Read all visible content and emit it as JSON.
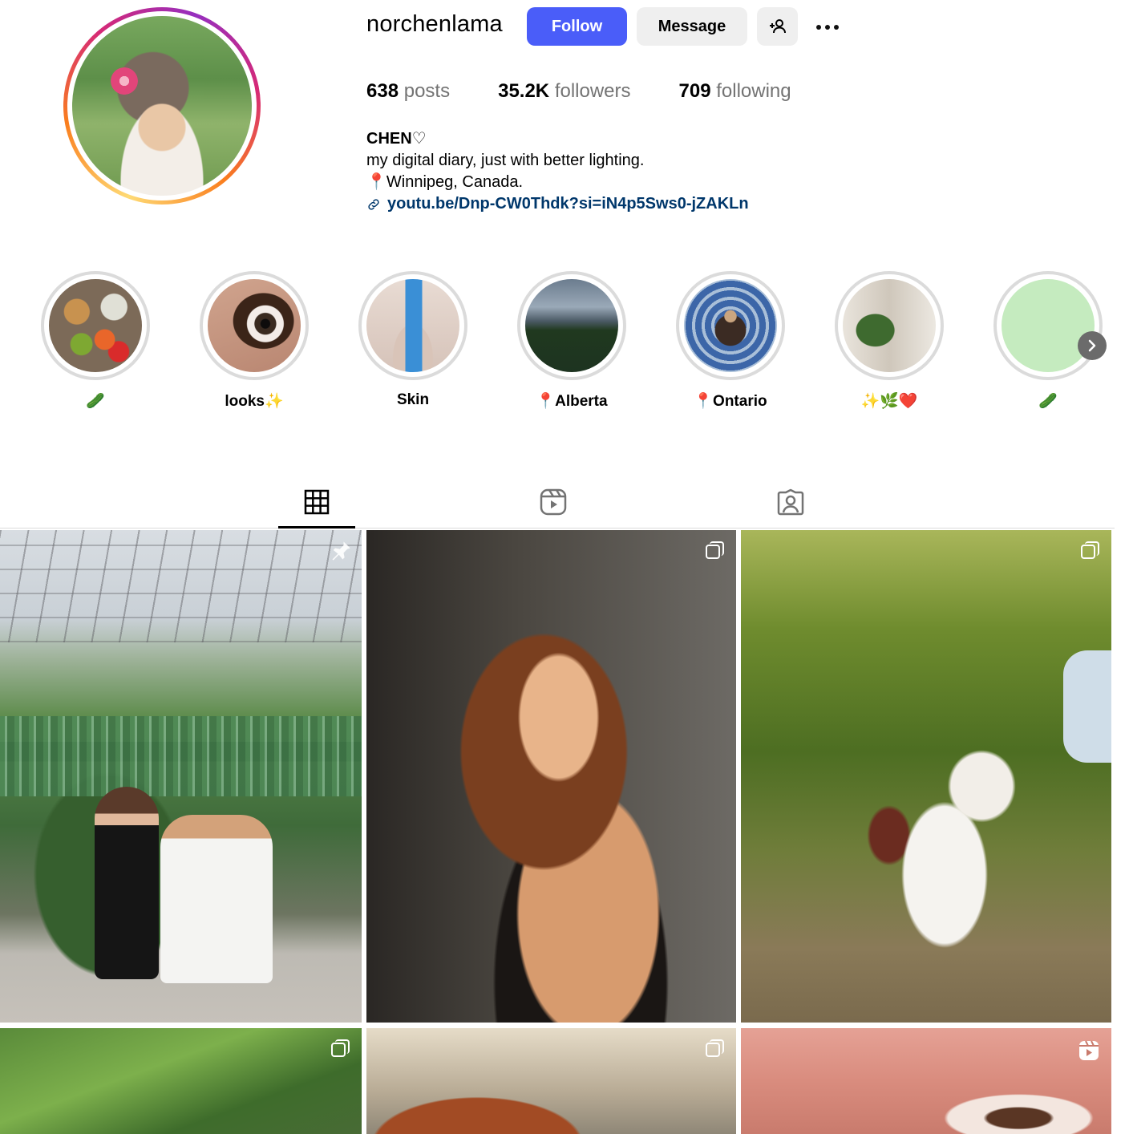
{
  "profile": {
    "username": "norchenlama",
    "follow_label": "Follow",
    "message_label": "Message",
    "stats": {
      "posts_count": "638",
      "posts_label": "posts",
      "followers_count": "35.2K",
      "followers_label": "followers",
      "following_count": "709",
      "following_label": "following"
    },
    "bio": {
      "name": "CHEN♡",
      "line1": "my digital diary, just with better lighting.",
      "location_pin": "📍",
      "location": "Winnipeg, Canada.",
      "link": "youtu.be/Dnp-CW0Thdk?si=iN4p5Sws0-jZAKLn"
    }
  },
  "highlights": [
    {
      "label": "🥒",
      "icon": "meal-prep"
    },
    {
      "label": "looks✨",
      "icon": "eye-closeup"
    },
    {
      "label": "Skin",
      "icon": "skincare-bottle"
    },
    {
      "label": "📍Alberta",
      "icon": "forest"
    },
    {
      "label": "📍Ontario",
      "icon": "art-figure"
    },
    {
      "label": "✨🌿❤️",
      "icon": "plant"
    },
    {
      "label": "🥒",
      "icon": "green-circle"
    }
  ],
  "tabs": [
    {
      "name": "posts",
      "icon": "grid-icon",
      "active": true
    },
    {
      "name": "reels",
      "icon": "reels-icon",
      "active": false
    },
    {
      "name": "tagged",
      "icon": "tagged-icon",
      "active": false
    }
  ],
  "posts": [
    {
      "subject": "proposal in greenhouse",
      "badge": "pin-icon"
    },
    {
      "subject": "curly hair selfie",
      "badge": "carousel-icon"
    },
    {
      "subject": "couple embracing on trail",
      "badge": "carousel-icon"
    },
    {
      "subject": "trees",
      "badge": "carousel-icon"
    },
    {
      "subject": "hair on couch",
      "badge": "carousel-icon"
    },
    {
      "subject": "eye closeup",
      "badge": "reel-icon"
    }
  ],
  "colors": {
    "follow_button": "#4a5df9",
    "secondary_button": "#efefef",
    "link": "#00376b",
    "muted_text": "#737373",
    "highlight_ring": "#dbdbdb"
  }
}
